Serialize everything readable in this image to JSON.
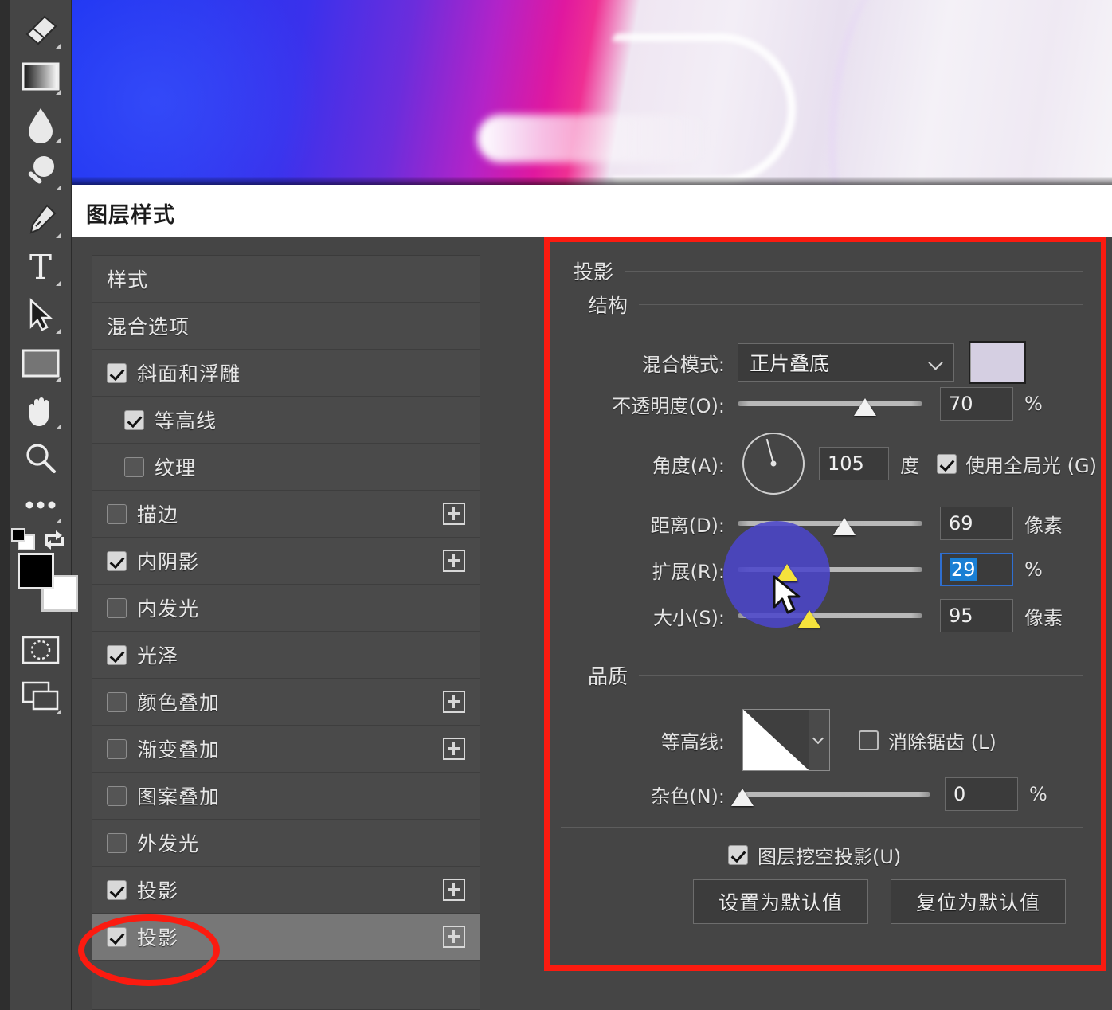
{
  "app": {
    "dialog_title": "图层样式"
  },
  "toolbar": {
    "tools": [
      {
        "name": "eraser-tool",
        "label": "橡皮擦工具"
      },
      {
        "name": "gradient-tool",
        "label": "渐变工具"
      },
      {
        "name": "blur-tool",
        "label": "模糊工具"
      },
      {
        "name": "dodge-tool",
        "label": "减淡工具"
      },
      {
        "name": "pen-tool",
        "label": "钢笔工具"
      },
      {
        "name": "type-tool",
        "label": "文字工具"
      },
      {
        "name": "path-selection-tool",
        "label": "路径选择工具"
      },
      {
        "name": "shape-tool",
        "label": "矩形工具"
      },
      {
        "name": "hand-tool",
        "label": "抓手工具"
      },
      {
        "name": "zoom-tool",
        "label": "缩放工具"
      },
      {
        "name": "more-tools",
        "label": "编辑工具栏"
      }
    ],
    "foreground_color": "#000000",
    "background_color": "#ffffff",
    "quick_mask_label": "以快速蒙版模式编辑",
    "screen_mode_label": "更改屏幕模式"
  },
  "styles_list": {
    "rows": [
      {
        "label": "样式",
        "type": "header",
        "checked": null,
        "plus": false,
        "indent": false,
        "selected": false
      },
      {
        "label": "混合选项",
        "type": "header",
        "checked": null,
        "plus": false,
        "indent": false,
        "selected": false
      },
      {
        "label": "斜面和浮雕",
        "type": "effect",
        "checked": true,
        "plus": false,
        "indent": false,
        "selected": false
      },
      {
        "label": "等高线",
        "type": "effect",
        "checked": true,
        "plus": false,
        "indent": true,
        "selected": false
      },
      {
        "label": "纹理",
        "type": "effect",
        "checked": false,
        "plus": false,
        "indent": true,
        "selected": false
      },
      {
        "label": "描边",
        "type": "effect",
        "checked": false,
        "plus": true,
        "indent": false,
        "selected": false
      },
      {
        "label": "内阴影",
        "type": "effect",
        "checked": true,
        "plus": true,
        "indent": false,
        "selected": false
      },
      {
        "label": "内发光",
        "type": "effect",
        "checked": false,
        "plus": false,
        "indent": false,
        "selected": false
      },
      {
        "label": "光泽",
        "type": "effect",
        "checked": true,
        "plus": false,
        "indent": false,
        "selected": false
      },
      {
        "label": "颜色叠加",
        "type": "effect",
        "checked": false,
        "plus": true,
        "indent": false,
        "selected": false
      },
      {
        "label": "渐变叠加",
        "type": "effect",
        "checked": false,
        "plus": true,
        "indent": false,
        "selected": false
      },
      {
        "label": "图案叠加",
        "type": "effect",
        "checked": false,
        "plus": false,
        "indent": false,
        "selected": false
      },
      {
        "label": "外发光",
        "type": "effect",
        "checked": false,
        "plus": false,
        "indent": false,
        "selected": false
      },
      {
        "label": "投影",
        "type": "effect",
        "checked": true,
        "plus": true,
        "indent": false,
        "selected": false
      },
      {
        "label": "投影",
        "type": "effect",
        "checked": true,
        "plus": true,
        "indent": false,
        "selected": true
      }
    ]
  },
  "drop_shadow": {
    "panel_title": "投影",
    "structure": {
      "section_label": "结构",
      "blend_mode_label": "混合模式:",
      "blend_mode_value": "正片叠底",
      "shadow_color": "#d5cfe2",
      "opacity_label": "不透明度(O):",
      "opacity_value": "70",
      "opacity_unit": "%",
      "angle_label": "角度(A):",
      "angle_value": "105",
      "angle_unit": "度",
      "global_light_label": "使用全局光 (G)",
      "global_light_checked": true,
      "distance_label": "距离(D):",
      "distance_value": "69",
      "distance_unit": "像素",
      "spread_label": "扩展(R):",
      "spread_value": "29",
      "spread_unit": "%",
      "spread_selected": true,
      "size_label": "大小(S):",
      "size_value": "95",
      "size_unit": "像素"
    },
    "quality": {
      "section_label": "品质",
      "contour_label": "等高线:",
      "anti_alias_label": "消除锯齿 (L)",
      "anti_alias_checked": false,
      "noise_label": "杂色(N):",
      "noise_value": "0",
      "noise_unit": "%"
    },
    "footer": {
      "knockout_label": "图层挖空投影(U)",
      "knockout_checked": true,
      "make_default_label": "设置为默认值",
      "reset_default_label": "复位为默认值"
    }
  },
  "annotations": {
    "highlight_color": "#fb1b10",
    "rect_target": "投影设置面板",
    "oval_target": "第二个投影效果项"
  },
  "overlay": {
    "circle_color": "#4b46c9",
    "cursor": "arrow-pointer"
  }
}
